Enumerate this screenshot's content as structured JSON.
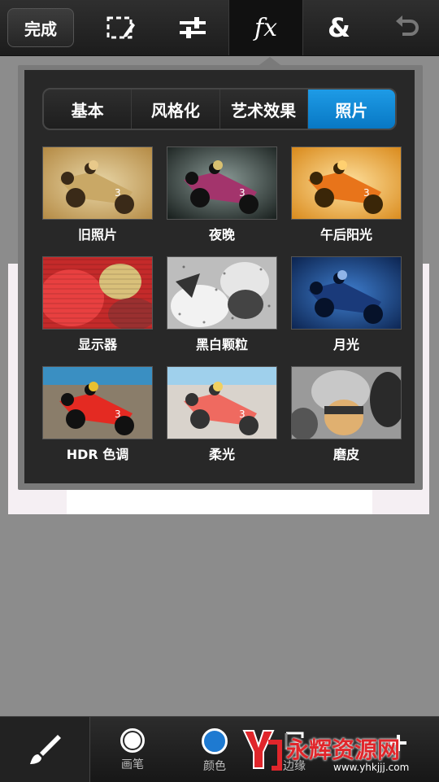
{
  "toolbar": {
    "done_label": "完成",
    "tools": [
      {
        "name": "select-icon"
      },
      {
        "name": "adjust-sliders-icon"
      },
      {
        "name": "fx-icon",
        "label": "fx"
      },
      {
        "name": "ampersand-icon",
        "label": "&"
      },
      {
        "name": "undo-icon"
      }
    ]
  },
  "effects_panel": {
    "tabs": [
      {
        "label": "基本",
        "active": false
      },
      {
        "label": "风格化",
        "active": false
      },
      {
        "label": "艺术效果",
        "active": false
      },
      {
        "label": "照片",
        "active": true
      }
    ],
    "effects": [
      {
        "label": "旧照片"
      },
      {
        "label": "夜晚"
      },
      {
        "label": "午后阳光"
      },
      {
        "label": "显示器"
      },
      {
        "label": "黑白颗粒"
      },
      {
        "label": "月光"
      },
      {
        "label": "HDR 色调"
      },
      {
        "label": "柔光"
      },
      {
        "label": "磨皮"
      }
    ]
  },
  "bottom_bar": {
    "pen_label": "画笔",
    "color_label": "颜色",
    "edge_label": "边缘",
    "accent_color": "#1e7ad1"
  },
  "watermark": {
    "text": "永辉资源网",
    "url": "www.yhkjjj.com"
  }
}
